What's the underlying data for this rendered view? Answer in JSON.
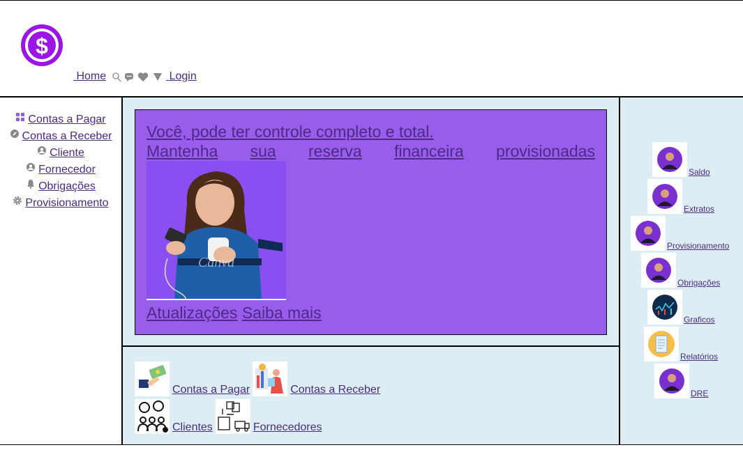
{
  "header": {
    "logo_icon": "dollar-coin-icon",
    "nav": {
      "home": "Home",
      "login": "Login"
    }
  },
  "sidebar": {
    "items": [
      {
        "label": "Contas a Pagar",
        "icon": "grid-icon"
      },
      {
        "label": "Contas a Receber",
        "icon": "compass-icon"
      },
      {
        "label": "Cliente",
        "icon": "user-circle-icon"
      },
      {
        "label": "Fornecedor",
        "icon": "user-circle-icon"
      },
      {
        "label": "Obrigações",
        "icon": "bell-icon"
      },
      {
        "label": "Provisionamento",
        "icon": "gear-icon"
      }
    ]
  },
  "hero": {
    "line1": "Você, pode ter controle completo e total.",
    "line2_words": [
      "Mantenha",
      "sua",
      "reserva",
      "financeira",
      "provisionadas"
    ],
    "photo_watermark": "Canva",
    "link_updates": "Atualizações",
    "link_more": "Saiba mais"
  },
  "shortcuts": [
    {
      "label": "Contas a Pagar"
    },
    {
      "label": "Contas a Receber"
    },
    {
      "label": "Clientes"
    },
    {
      "label": "Fornecedores"
    }
  ],
  "right_menu": [
    {
      "label": "Saldo"
    },
    {
      "label": "Extratos"
    },
    {
      "label": "Provisionamento"
    },
    {
      "label": "Obrigações"
    },
    {
      "label": "Graficos"
    },
    {
      "label": "Relatórios"
    },
    {
      "label": "DRE"
    }
  ],
  "colors": {
    "accent_purple": "#9a5ceb",
    "panel_bg": "#dcedf4",
    "link": "#4a2b85",
    "logo": "#9b16e6"
  }
}
